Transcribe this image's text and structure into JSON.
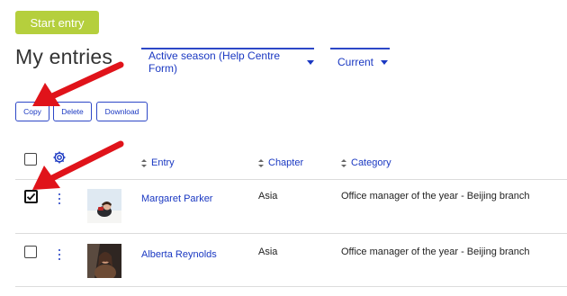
{
  "start_entry_label": "Start entry",
  "page_title": "My entries",
  "filters": {
    "season": "Active season (Help Centre Form)",
    "status": "Current"
  },
  "actions": {
    "copy": "Copy",
    "delete": "Delete",
    "download": "Download"
  },
  "table": {
    "headers": {
      "entry": "Entry",
      "chapter": "Chapter",
      "category": "Category"
    },
    "rows": [
      {
        "entry": "Margaret Parker",
        "chapter": "Asia",
        "category": "Office manager of the year - Beijing branch",
        "selected": true
      },
      {
        "entry": "Alberta Reynolds",
        "chapter": "Asia",
        "category": "Office manager of the year - Beijing branch",
        "selected": false
      }
    ]
  },
  "colors": {
    "accent": "#1a38c2",
    "start_button": "#b5cf3d",
    "annotation_arrow": "#e0131a"
  },
  "icons": [
    "settings-gear-icon",
    "sort-icon",
    "kebab-menu-icon",
    "caret-down-icon"
  ]
}
